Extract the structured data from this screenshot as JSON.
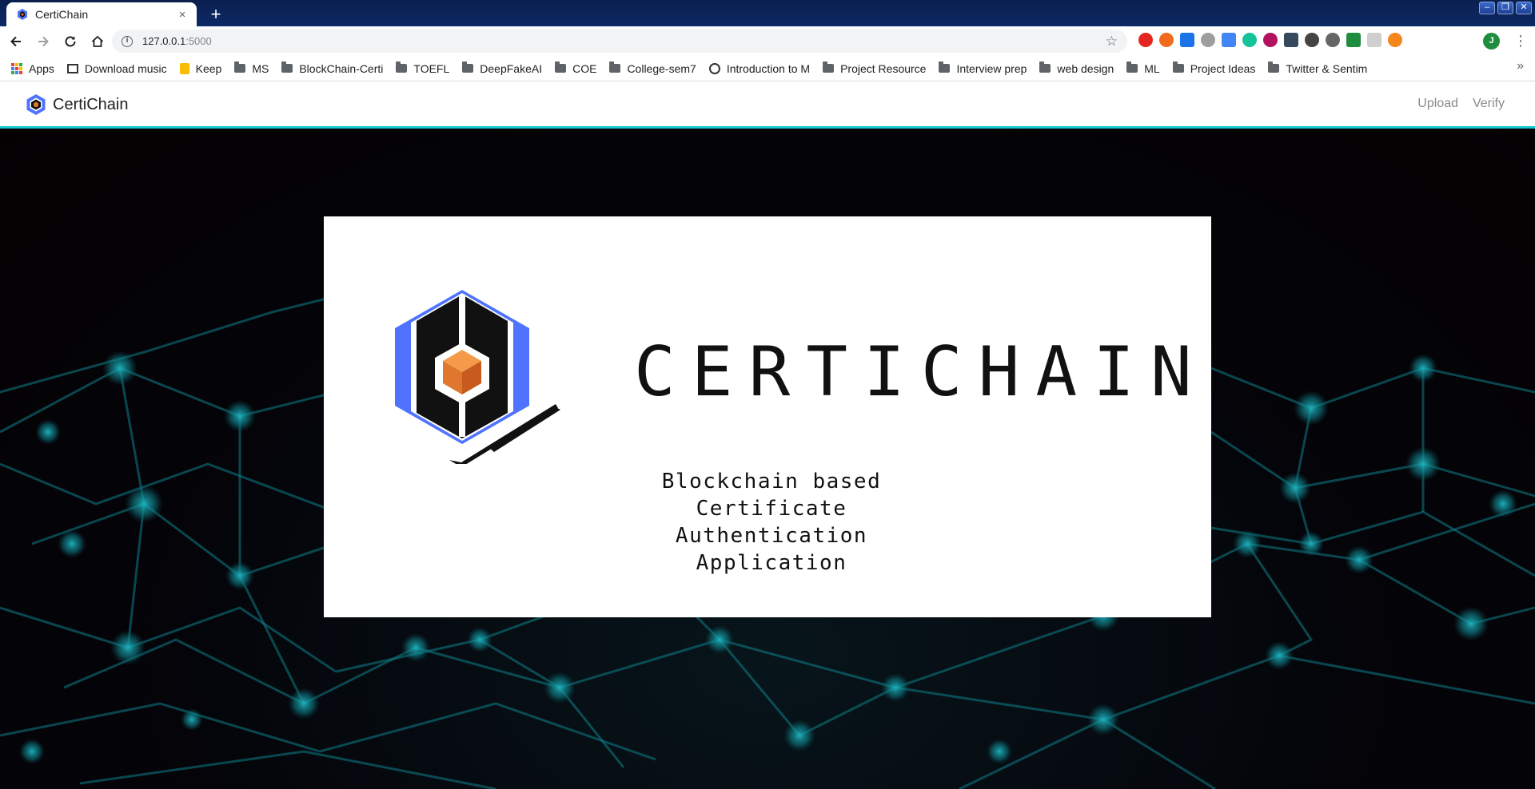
{
  "browser": {
    "tab_title": "CertiChain",
    "tab_close": "×",
    "new_tab": "+",
    "window_controls": [
      "–",
      "❐",
      "✕"
    ],
    "url_host": "127.0.0.1",
    "url_port": ":5000",
    "info_glyph": "i",
    "star_glyph": "☆",
    "profile_initial": "J",
    "menu_glyph": "⋮",
    "bookmarks": [
      {
        "label": "Apps",
        "icon": "apps-icon"
      },
      {
        "label": "Download music",
        "icon": "music-icon"
      },
      {
        "label": "Keep",
        "icon": "keep-icon"
      },
      {
        "label": "MS",
        "icon": "folder-icon"
      },
      {
        "label": "BlockChain-Certi",
        "icon": "folder-icon"
      },
      {
        "label": "TOEFL",
        "icon": "folder-icon"
      },
      {
        "label": "DeepFakeAI",
        "icon": "folder-icon"
      },
      {
        "label": "COE",
        "icon": "folder-icon"
      },
      {
        "label": "College-sem7",
        "icon": "folder-icon"
      },
      {
        "label": "Introduction to M",
        "icon": "globe-icon"
      },
      {
        "label": "Project Resource",
        "icon": "folder-icon"
      },
      {
        "label": "Interview prep",
        "icon": "folder-icon"
      },
      {
        "label": "web design",
        "icon": "folder-icon"
      },
      {
        "label": "ML",
        "icon": "folder-icon"
      },
      {
        "label": "Project Ideas",
        "icon": "folder-icon"
      },
      {
        "label": "Twitter & Sentim",
        "icon": "folder-icon"
      }
    ],
    "bookmarks_overflow": "»"
  },
  "navbar": {
    "brand": "CertiChain",
    "links": [
      "Upload",
      "Verify"
    ]
  },
  "banner": {
    "title": "CERTICHAIN",
    "subtitle": "Blockchain based Certificate Authentication Application"
  },
  "colors": {
    "accent": "#17c6cf",
    "logo_blue": "#4f73ff",
    "logo_orange": "#e0772e"
  }
}
